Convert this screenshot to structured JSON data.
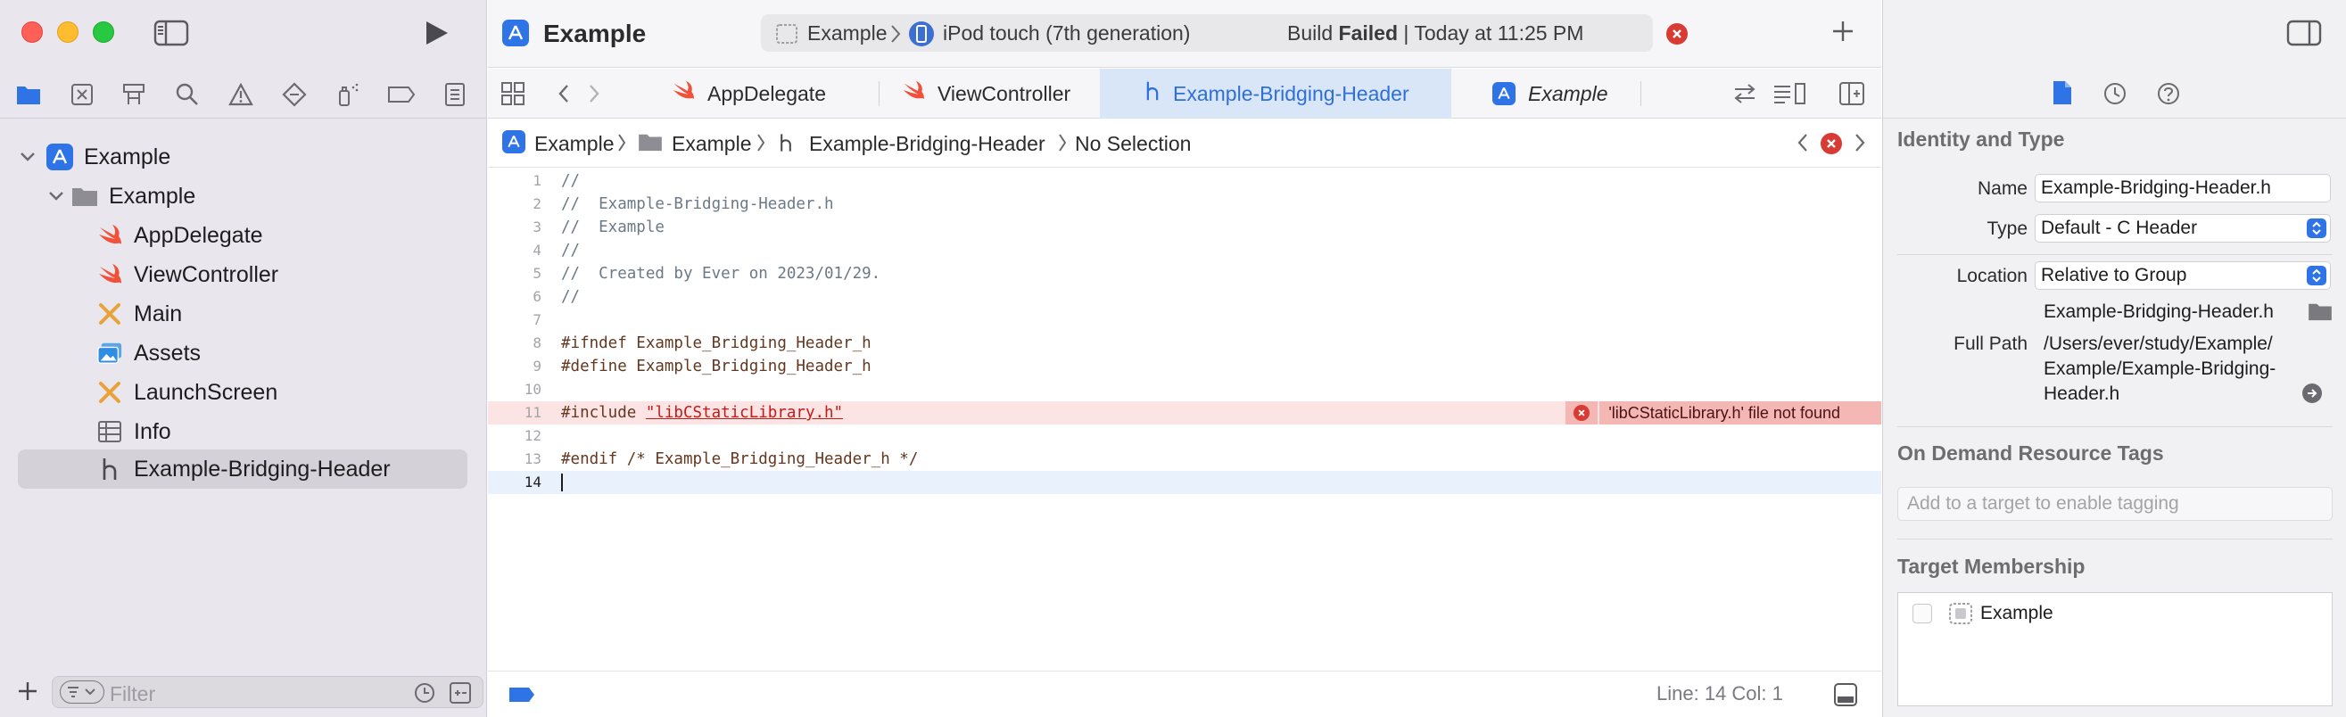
{
  "window": {
    "project_name": "Example",
    "scheme": {
      "target": "Example",
      "device": "iPod touch (7th generation)",
      "build_prefix": "Build ",
      "build_status": "Failed",
      "build_time": "| Today at 11:25 PM"
    }
  },
  "navigator": {
    "tree": [
      {
        "label": "Example",
        "icon": "app-project-icon"
      },
      {
        "label": "Example",
        "icon": "folder-icon"
      },
      {
        "label": "AppDelegate",
        "icon": "swift-icon"
      },
      {
        "label": "ViewController",
        "icon": "swift-icon"
      },
      {
        "label": "Main",
        "icon": "storyboard-icon"
      },
      {
        "label": "Assets",
        "icon": "asset-catalog-icon"
      },
      {
        "label": "LaunchScreen",
        "icon": "storyboard-icon"
      },
      {
        "label": "Info",
        "icon": "plist-table-icon"
      },
      {
        "label": "Example-Bridging-Header",
        "icon": "header-h-icon"
      }
    ],
    "filter_placeholder": "Filter"
  },
  "tabs": [
    {
      "label": "AppDelegate",
      "icon": "swift-icon"
    },
    {
      "label": "ViewController",
      "icon": "swift-icon"
    },
    {
      "label": "Example-Bridging-Header",
      "icon": "header-h-icon"
    },
    {
      "label": "Example",
      "icon": "app-project-icon"
    }
  ],
  "jumpbar": {
    "project": "Example",
    "group": "Example",
    "file": "Example-Bridging-Header",
    "selection": "No Selection"
  },
  "code": {
    "lines": [
      {
        "n": "1",
        "text": "//"
      },
      {
        "n": "2",
        "text": "//  Example-Bridging-Header.h"
      },
      {
        "n": "3",
        "text": "//  Example"
      },
      {
        "n": "4",
        "text": "//"
      },
      {
        "n": "5",
        "text": "//  Created by Ever on 2023/01/29."
      },
      {
        "n": "6",
        "text": "//"
      },
      {
        "n": "7",
        "text": ""
      },
      {
        "n": "8",
        "text": "#ifndef Example_Bridging_Header_h"
      },
      {
        "n": "9",
        "text": "#define Example_Bridging_Header_h"
      },
      {
        "n": "10",
        "text": ""
      },
      {
        "n": "11",
        "pre": "#include ",
        "str": "\"libCStaticLibrary.h\""
      },
      {
        "n": "12",
        "text": ""
      },
      {
        "n": "13",
        "text": "#endif /* Example_Bridging_Header_h */"
      },
      {
        "n": "14",
        "text": ""
      }
    ],
    "error_message": "'libCStaticLibrary.h' file not found"
  },
  "status": {
    "line_col": "Line: 14  Col: 1"
  },
  "inspector": {
    "identity_title": "Identity and Type",
    "name_label": "Name",
    "name_value": "Example-Bridging-Header.h",
    "type_label": "Type",
    "type_value": "Default - C Header",
    "location_label": "Location",
    "location_value": "Relative to Group",
    "location_file": "Example-Bridging-Header.h",
    "fullpath_label": "Full Path",
    "fullpath_line1": "/Users/ever/study/Example/",
    "fullpath_line2": "Example/Example-Bridging-",
    "fullpath_line3": "Header.h",
    "odr_title": "On Demand Resource Tags",
    "odr_placeholder": "Add to a target to enable tagging",
    "membership_title": "Target Membership",
    "membership_target": "Example"
  },
  "colors": {
    "accent": "#2f74e6",
    "error": "#d83a34",
    "error_line_bg": "#fbe4e3",
    "swift": "#f05138"
  }
}
